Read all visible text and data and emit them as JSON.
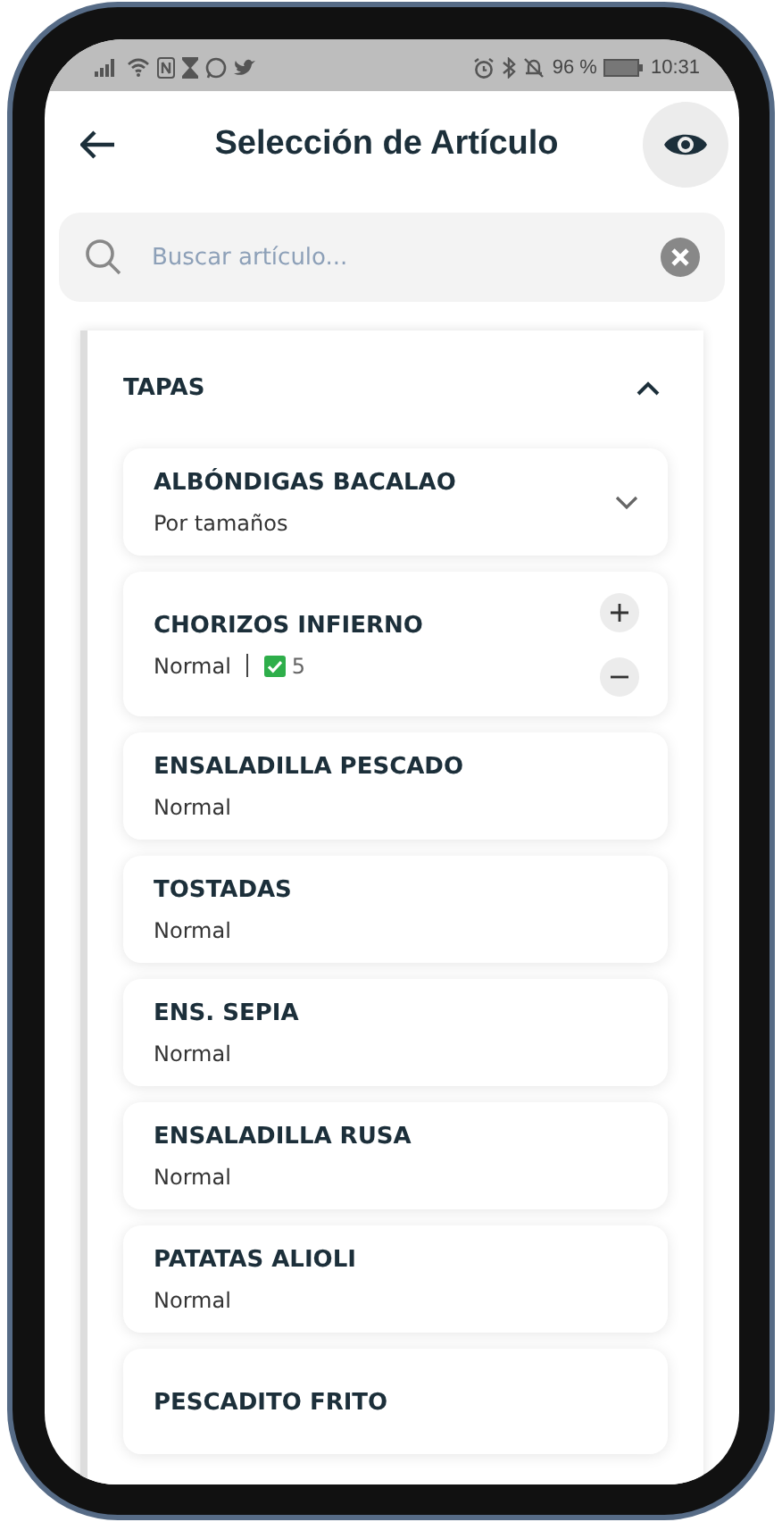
{
  "status_bar": {
    "battery_percent": "96 %",
    "time": "10:31"
  },
  "header": {
    "title": "Selección de Artículo"
  },
  "search": {
    "placeholder": "Buscar artículo..."
  },
  "category": {
    "name": "TAPAS",
    "expanded": true,
    "items": [
      {
        "kind": "sizes",
        "name": "ALBÓNDIGAS BACALAO",
        "detail": "Por tamaños"
      },
      {
        "kind": "quantity",
        "name": "CHORIZOS INFIERNO",
        "detail": "Normal",
        "count": "5"
      },
      {
        "kind": "plain",
        "name": "ENSALADILLA PESCADO",
        "detail": "Normal"
      },
      {
        "kind": "plain",
        "name": "TOSTADAS",
        "detail": "Normal"
      },
      {
        "kind": "plain",
        "name": "ENS. SEPIA",
        "detail": "Normal"
      },
      {
        "kind": "plain",
        "name": "ENSALADILLA RUSA",
        "detail": "Normal"
      },
      {
        "kind": "plain",
        "name": "PATATAS ALIOLI",
        "detail": "Normal"
      },
      {
        "kind": "plain",
        "name": "PESCADITO FRITO"
      }
    ]
  }
}
